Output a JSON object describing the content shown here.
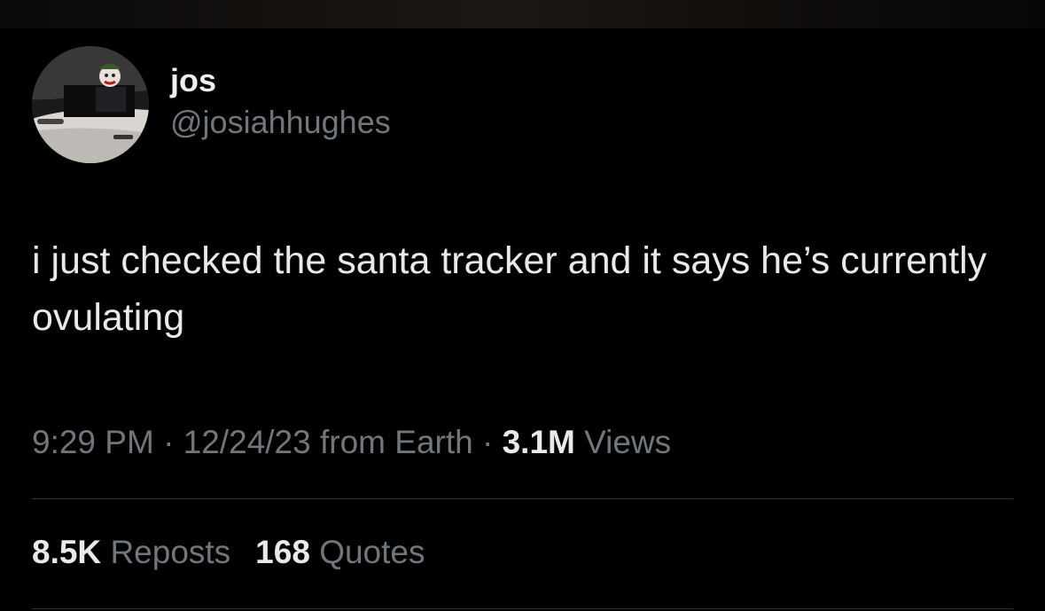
{
  "tweet": {
    "display_name": "jos",
    "handle": "@josiahhughes",
    "text": "i just checked the santa tracker and it says he’s currently ovulating",
    "time": "9:29 PM",
    "date": "12/24/23",
    "source": "from Earth",
    "separator": "·",
    "views_count": "3.1M",
    "views_label": "Views"
  },
  "stats": {
    "reposts_count": "8.5K",
    "reposts_label": "Reposts",
    "quotes_count": "168",
    "quotes_label": "Quotes"
  },
  "colors": {
    "background": "#000000",
    "primary_text": "#e7e9ea",
    "secondary_text": "#71767b",
    "divider": "#2f3336"
  }
}
